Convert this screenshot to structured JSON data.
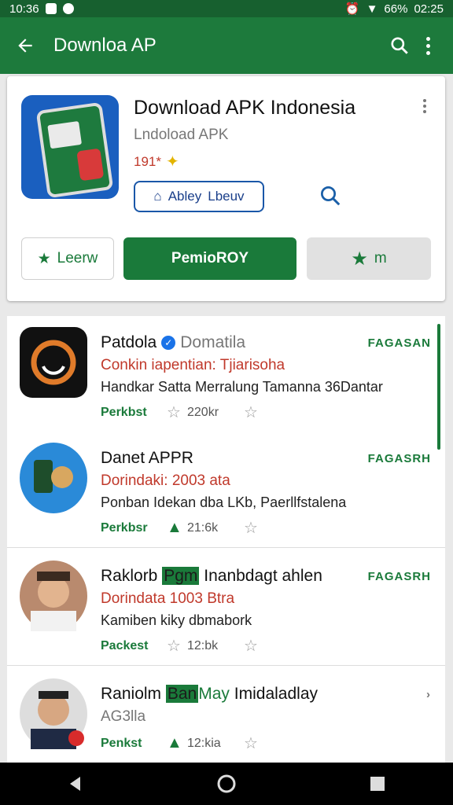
{
  "status_bar": {
    "time_left": "10:36",
    "battery": "66%",
    "time_right": "02:25"
  },
  "app_bar": {
    "title": "Downloa AP"
  },
  "app_card": {
    "title": "Download APK Indonesia",
    "subtitle": "Lndoload APK",
    "rating": "191*",
    "pill_label": "Abley",
    "pill_label2": "Lbeuv",
    "buttons": {
      "left": "Leerw",
      "primary": "PemioROY",
      "right": "m"
    }
  },
  "list": [
    {
      "name": "Patdola",
      "name_suffix": "Domatila",
      "sub": "Conkin iapentian: Tjiarisoha",
      "desc": "Handkar Satta Merralung Tamanna 36Dantar",
      "meta_label": "Perkbst",
      "count": "220kr",
      "tag": "FAGASAN"
    },
    {
      "name": "Danet APPR",
      "sub": "Dorindaki: 2003 ata",
      "desc": "Ponban Idekan dba LKb, Paerllfstalena",
      "meta_label": "Perkbsr",
      "count": "21:6k",
      "tag": "FAGASRH"
    },
    {
      "name": "Raklorb",
      "name_hl": "Pgm",
      "name_rest": "Inanbdagt ahlen",
      "sub": "Dorindata 1003 Btra",
      "desc": "Kamiben kiky dbmabork",
      "meta_label": "Packest",
      "count": "12:bk",
      "tag": "FAGASRH"
    },
    {
      "name": "Raniolm",
      "name_hl": "Ban",
      "name_hl2": "May",
      "name_rest": "Imidaladlay",
      "sub": "AG3lla",
      "meta_label": "Penkst",
      "count": "12:kia"
    }
  ],
  "colors": {
    "app_bar": "#1d7a3c",
    "accent_green": "#1a7a3a",
    "red_text": "#c0392b"
  }
}
